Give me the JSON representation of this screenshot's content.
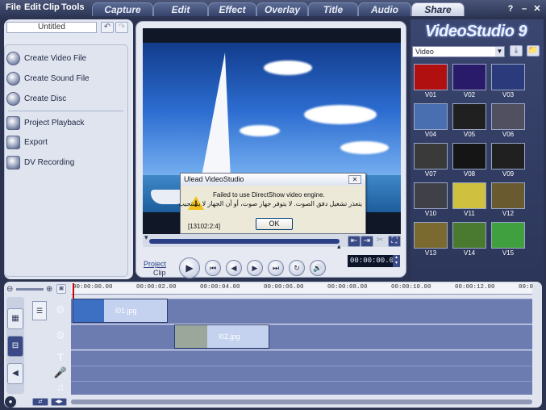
{
  "menu": [
    "File",
    "Edit",
    "Clip",
    "Tools"
  ],
  "tabs": [
    {
      "label": "Capture",
      "active": false
    },
    {
      "label": "Edit",
      "active": false
    },
    {
      "label": "Effect",
      "active": false
    },
    {
      "label": "Overlay",
      "active": false
    },
    {
      "label": "Title",
      "active": false
    },
    {
      "label": "Audio",
      "active": false
    },
    {
      "label": "Share",
      "active": true
    }
  ],
  "window_buttons": [
    "?",
    "–",
    "✕"
  ],
  "project_title": "Untitled",
  "options": [
    "Create Video File",
    "Create Sound File",
    "Create Disc",
    "Project Playback",
    "Export",
    "DV Recording"
  ],
  "dialog": {
    "title": "Ulead VideoStudio",
    "message_en": "Failed to use DirectShow video engine.",
    "message_ar": "يتعذر تشغيل دفق الصوت. لا يتوفر جهاز صوت، أو أن الجهاز لا يستجيب",
    "code": "[13102:2:4]",
    "ok": "OK"
  },
  "playback": {
    "project_label": "Project",
    "clip_label": "Clip",
    "timecode": "00:00:00.00"
  },
  "logo": "VideoStudio 9",
  "library": {
    "category": "Video",
    "items": [
      "V01",
      "V02",
      "V03",
      "V04",
      "V05",
      "V06",
      "V07",
      "V08",
      "V09",
      "V10",
      "V11",
      "V12",
      "V13",
      "V14",
      "V15"
    ]
  },
  "ruler_ticks": [
    "00:00:00.00",
    "00:00:02.00",
    "00:00:04.00",
    "00:00:06.00",
    "00:00:08.00",
    "00:00:10.00",
    "00:00:12.00",
    "00:0"
  ],
  "clips": [
    {
      "label": "l01.jpg"
    },
    {
      "label": "l02.jpg"
    }
  ],
  "colors": {
    "accent": "#2b3f86",
    "panel": "#dfe4ef",
    "track": "#6c7bb0"
  }
}
